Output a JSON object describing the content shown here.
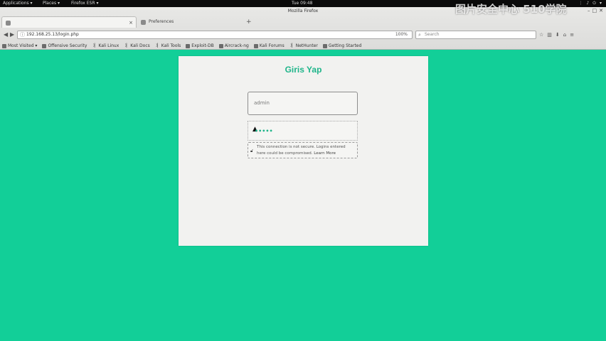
{
  "topbar": {
    "applications": "Applications ▾",
    "places": "Places ▾",
    "firefox": "Firefox ESR ▾",
    "clock": "Tue 09:48"
  },
  "window": {
    "title": "Mozilla Firefox"
  },
  "tabs": [
    {
      "label": ""
    },
    {
      "label": "Preferences"
    }
  ],
  "url": {
    "value": "192.168.25.13/login.php",
    "zoom": "100%"
  },
  "search": {
    "placeholder": "Search"
  },
  "bookmarks": [
    {
      "label": "Most Visited ▾",
      "icon": "gear-icon"
    },
    {
      "label": "Offensive Security",
      "icon": "page-icon"
    },
    {
      "label": "Kali Linux",
      "icon": "kali-icon"
    },
    {
      "label": "Kali Docs",
      "icon": "kali-icon"
    },
    {
      "label": "Kali Tools",
      "icon": "kali-icon"
    },
    {
      "label": "Exploit-DB",
      "icon": "page-icon"
    },
    {
      "label": "Aircrack-ng",
      "icon": "page-icon"
    },
    {
      "label": "Kali Forums",
      "icon": "page-icon"
    },
    {
      "label": "NetHunter",
      "icon": "kali-icon"
    },
    {
      "label": "Getting Started",
      "icon": "page-icon"
    }
  ],
  "watermark": "图片安全中心 510学院",
  "page": {
    "title": "Giris Yap",
    "username_value": "admin",
    "password_dots": "•••••",
    "warning_text": "This connection is not secure. Logins entered here could be compromised.",
    "learn_more": "Learn More"
  },
  "colors": {
    "page_bg": "#12cf98",
    "accent": "#1fb58a",
    "card_bg": "#f2f2f0"
  }
}
